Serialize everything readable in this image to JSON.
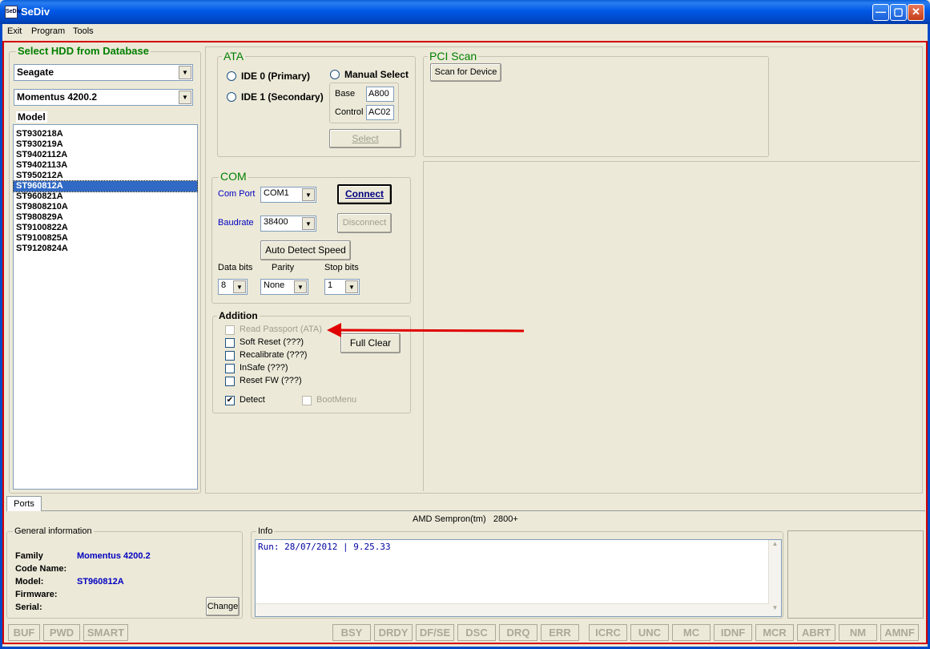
{
  "window": {
    "title": "SeDiv",
    "icon_text": "SeDiv"
  },
  "menu": [
    "Exit",
    "Program",
    "Tools"
  ],
  "hdd_db": {
    "title": "Select HDD from Database",
    "vendor": "Seagate",
    "family": "Momentus 4200.2",
    "model_header": "Model",
    "models": [
      "ST930218A",
      "ST930219A",
      "ST9402112A",
      "ST9402113A",
      "ST950212A",
      "ST960812A",
      "ST960821A",
      "ST9808210A",
      "ST980829A",
      "ST9100822A",
      "ST9100825A",
      "ST9120824A"
    ],
    "selected": "ST960812A"
  },
  "ata": {
    "title": "ATA",
    "ide0": "IDE 0 (Primary)",
    "ide1": "IDE 1 (Secondary)",
    "manual": "Manual Select",
    "base_label": "Base",
    "base_value": "A800",
    "control_label": "Control",
    "control_value": "AC02",
    "select_button": "Select"
  },
  "pci": {
    "title": "PCI Scan",
    "scan_button": "Scan for Device"
  },
  "com": {
    "title": "COM",
    "port_label": "Com Port",
    "port_value": "COM1",
    "baud_label": "Baudrate",
    "baud_value": "38400",
    "connect_button": "Connect",
    "disconnect_button": "Disconnect",
    "autodetect_button": "Auto Detect Speed",
    "databits_label": "Data bits",
    "databits_value": "8",
    "parity_label": "Parity",
    "parity_value": "None",
    "stopbits_label": "Stop bits",
    "stopbits_value": "1"
  },
  "addition": {
    "title": "Addition",
    "read_passport": "Read Passport (ATA)",
    "soft_reset": "Soft Reset (???)",
    "recalibrate": "Recalibrate (???)",
    "insafe": "InSafe (???)",
    "reset_fw": "Reset FW (???)",
    "detect": "Detect",
    "detect_checked": true,
    "bootmenu": "BootMenu",
    "full_clear_button": "Full Clear"
  },
  "tabs": {
    "ports": "Ports"
  },
  "cpu": "AMD Sempron(tm)   2800+",
  "general": {
    "title": "General information",
    "family_label": "Family",
    "family_value": "Momentus 4200.2",
    "codename_label": "Code Name:",
    "model_label": "Model:",
    "model_value": "ST960812A",
    "firmware_label": "Firmware:",
    "serial_label": "Serial:",
    "change_button": "Change"
  },
  "info": {
    "title": "Info",
    "log": "Run: 28/07/2012 | 9.25.33"
  },
  "status": {
    "group1": [
      "BUF",
      "PWD",
      "SMART"
    ],
    "group2": [
      "BSY",
      "DRDY",
      "DF/SE",
      "DSC",
      "DRQ",
      "ERR"
    ],
    "group3": [
      "ICRC",
      "UNC",
      "MC",
      "IDNF",
      "MCR",
      "ABRT",
      "NM",
      "AMNF"
    ]
  },
  "annotation": {
    "arrow_color": "#e00000"
  }
}
